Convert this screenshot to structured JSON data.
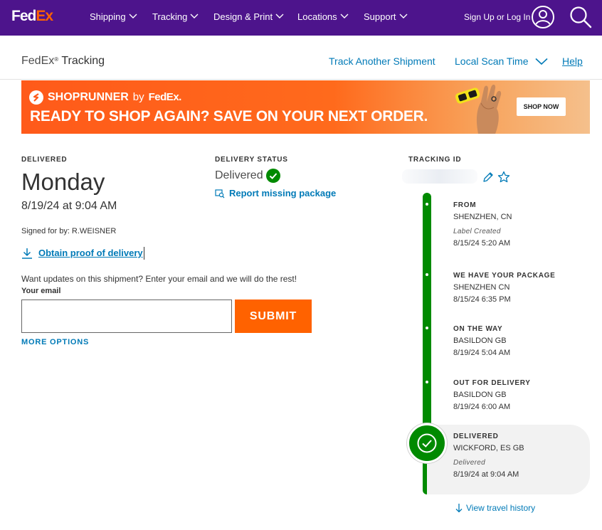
{
  "nav": {
    "logo_fed": "Fed",
    "logo_ex": "Ex",
    "items": [
      "Shipping",
      "Tracking",
      "Design & Print",
      "Locations",
      "Support"
    ],
    "signin": "Sign Up or Log In"
  },
  "subheader": {
    "title_pre": "FedEx",
    "title_reg": "®",
    "title_post": " Tracking",
    "track_another": "Track Another Shipment",
    "local_scan": "Local Scan Time",
    "help": "Help"
  },
  "banner": {
    "brand": "SHOPRUNNER",
    "by": "by",
    "fedex": "FedEx.",
    "headline": "READY TO SHOP AGAIN? SAVE ON YOUR NEXT ORDER.",
    "cta": "SHOP NOW"
  },
  "delivery": {
    "label": "DELIVERED",
    "day": "Monday",
    "datetime": "8/19/24 at 9:04 AM",
    "signed_for": "Signed for by: R.WEISNER",
    "proof_link": "Obtain proof of delivery"
  },
  "updates": {
    "prompt": "Want updates on this shipment? Enter your email and we will do the rest!",
    "email_label": "Your email",
    "email_value": "",
    "submit": "SUBMIT",
    "more_options": "MORE OPTIONS"
  },
  "status": {
    "label": "DELIVERY STATUS",
    "value": "Delivered",
    "report_link": "Report missing package"
  },
  "tracking": {
    "label": "TRACKING ID",
    "events": [
      {
        "heading": "FROM",
        "location": "SHENZHEN, CN",
        "status": "Label Created",
        "time": "8/15/24 5:20 AM"
      },
      {
        "heading": "WE HAVE YOUR PACKAGE",
        "location": "SHENZHEN CN",
        "time": "8/15/24 6:35 PM"
      },
      {
        "heading": "ON THE WAY",
        "location": "BASILDON GB",
        "time": "8/19/24 5:04 AM"
      },
      {
        "heading": "OUT FOR DELIVERY",
        "location": "BASILDON GB",
        "time": "8/19/24 6:00 AM"
      },
      {
        "heading": "DELIVERED",
        "location": "WICKFORD, ES GB",
        "status": "Delivered",
        "time": "8/19/24 at 9:04 AM"
      }
    ],
    "travel_history": "View travel history"
  },
  "colors": {
    "brand_purple": "#4d148c",
    "brand_orange": "#ff6200",
    "link_blue": "#007ab7",
    "success_green": "#008a00"
  }
}
